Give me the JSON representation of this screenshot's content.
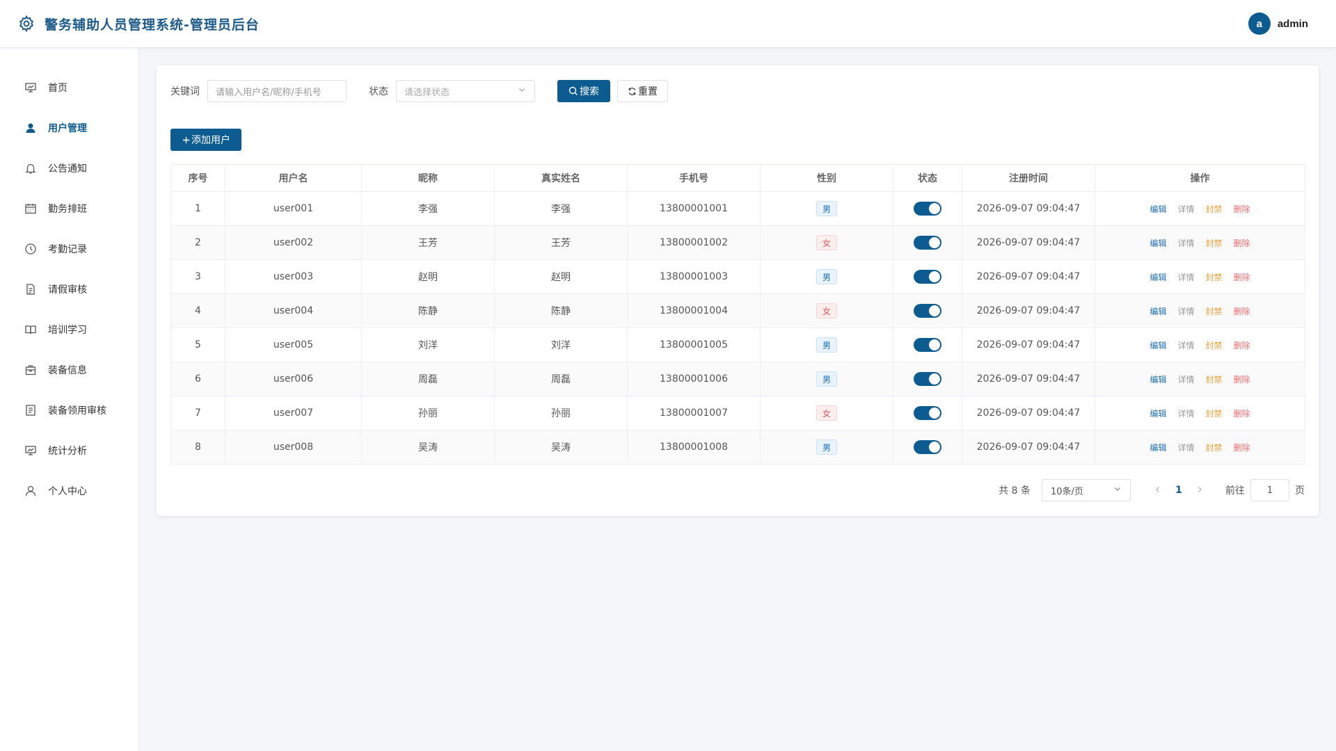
{
  "header": {
    "title": "警务辅助人员管理系统-管理员后台",
    "logo_icon": "gear-icon",
    "avatar_letter": "a",
    "username": "admin"
  },
  "sidebar": {
    "items": [
      {
        "label": "首页",
        "icon": "dashboard-icon"
      },
      {
        "label": "用户管理",
        "icon": "user-icon",
        "active": true
      },
      {
        "label": "公告通知",
        "icon": "bell-icon"
      },
      {
        "label": "勤务排班",
        "icon": "calendar-icon"
      },
      {
        "label": "考勤记录",
        "icon": "clock-icon"
      },
      {
        "label": "请假审核",
        "icon": "document-icon"
      },
      {
        "label": "培训学习",
        "icon": "book-icon"
      },
      {
        "label": "装备信息",
        "icon": "bag-icon"
      },
      {
        "label": "装备领用审核",
        "icon": "checklist-icon"
      },
      {
        "label": "统计分析",
        "icon": "chart-icon"
      },
      {
        "label": "个人中心",
        "icon": "person-icon"
      }
    ]
  },
  "filters": {
    "keyword_label": "关键词",
    "keyword_placeholder": "请输入用户名/昵称/手机号",
    "status_label": "状态",
    "status_placeholder": "请选择状态",
    "search_label": "搜索",
    "reset_label": "重置"
  },
  "toolbar": {
    "add_label": "添加用户"
  },
  "table": {
    "columns": [
      "序号",
      "用户名",
      "昵称",
      "真实姓名",
      "手机号",
      "性别",
      "状态",
      "注册时间",
      "操作"
    ],
    "rows": [
      {
        "no": "1",
        "username": "user001",
        "nickname": "李强",
        "realname": "李强",
        "phone": "13800001001",
        "gender": "男",
        "registered": "2026-09-07 09:04:47"
      },
      {
        "no": "2",
        "username": "user002",
        "nickname": "王芳",
        "realname": "王芳",
        "phone": "13800001002",
        "gender": "女",
        "registered": "2026-09-07 09:04:47"
      },
      {
        "no": "3",
        "username": "user003",
        "nickname": "赵明",
        "realname": "赵明",
        "phone": "13800001003",
        "gender": "男",
        "registered": "2026-09-07 09:04:47"
      },
      {
        "no": "4",
        "username": "user004",
        "nickname": "陈静",
        "realname": "陈静",
        "phone": "13800001004",
        "gender": "女",
        "registered": "2026-09-07 09:04:47"
      },
      {
        "no": "5",
        "username": "user005",
        "nickname": "刘洋",
        "realname": "刘洋",
        "phone": "13800001005",
        "gender": "男",
        "registered": "2026-09-07 09:04:47"
      },
      {
        "no": "6",
        "username": "user006",
        "nickname": "周磊",
        "realname": "周磊",
        "phone": "13800001006",
        "gender": "男",
        "registered": "2026-09-07 09:04:47"
      },
      {
        "no": "7",
        "username": "user007",
        "nickname": "孙丽",
        "realname": "孙丽",
        "phone": "13800001007",
        "gender": "女",
        "registered": "2026-09-07 09:04:47"
      },
      {
        "no": "8",
        "username": "user008",
        "nickname": "吴涛",
        "realname": "吴涛",
        "phone": "13800001008",
        "gender": "男",
        "registered": "2026-09-07 09:04:47"
      }
    ],
    "ops": {
      "edit": "编辑",
      "detail": "详情",
      "ban": "封禁",
      "delete": "删除"
    }
  },
  "pagination": {
    "total_text": "共 8 条",
    "page_size": "10条/页",
    "current_page": "1",
    "goto_label": "前往",
    "goto_value": "1",
    "page_suffix": "页"
  },
  "colors": {
    "primary": "#0d5c91",
    "edit": "#1d6fb3",
    "ban": "#e6a23c",
    "delete": "#f56c6c"
  }
}
